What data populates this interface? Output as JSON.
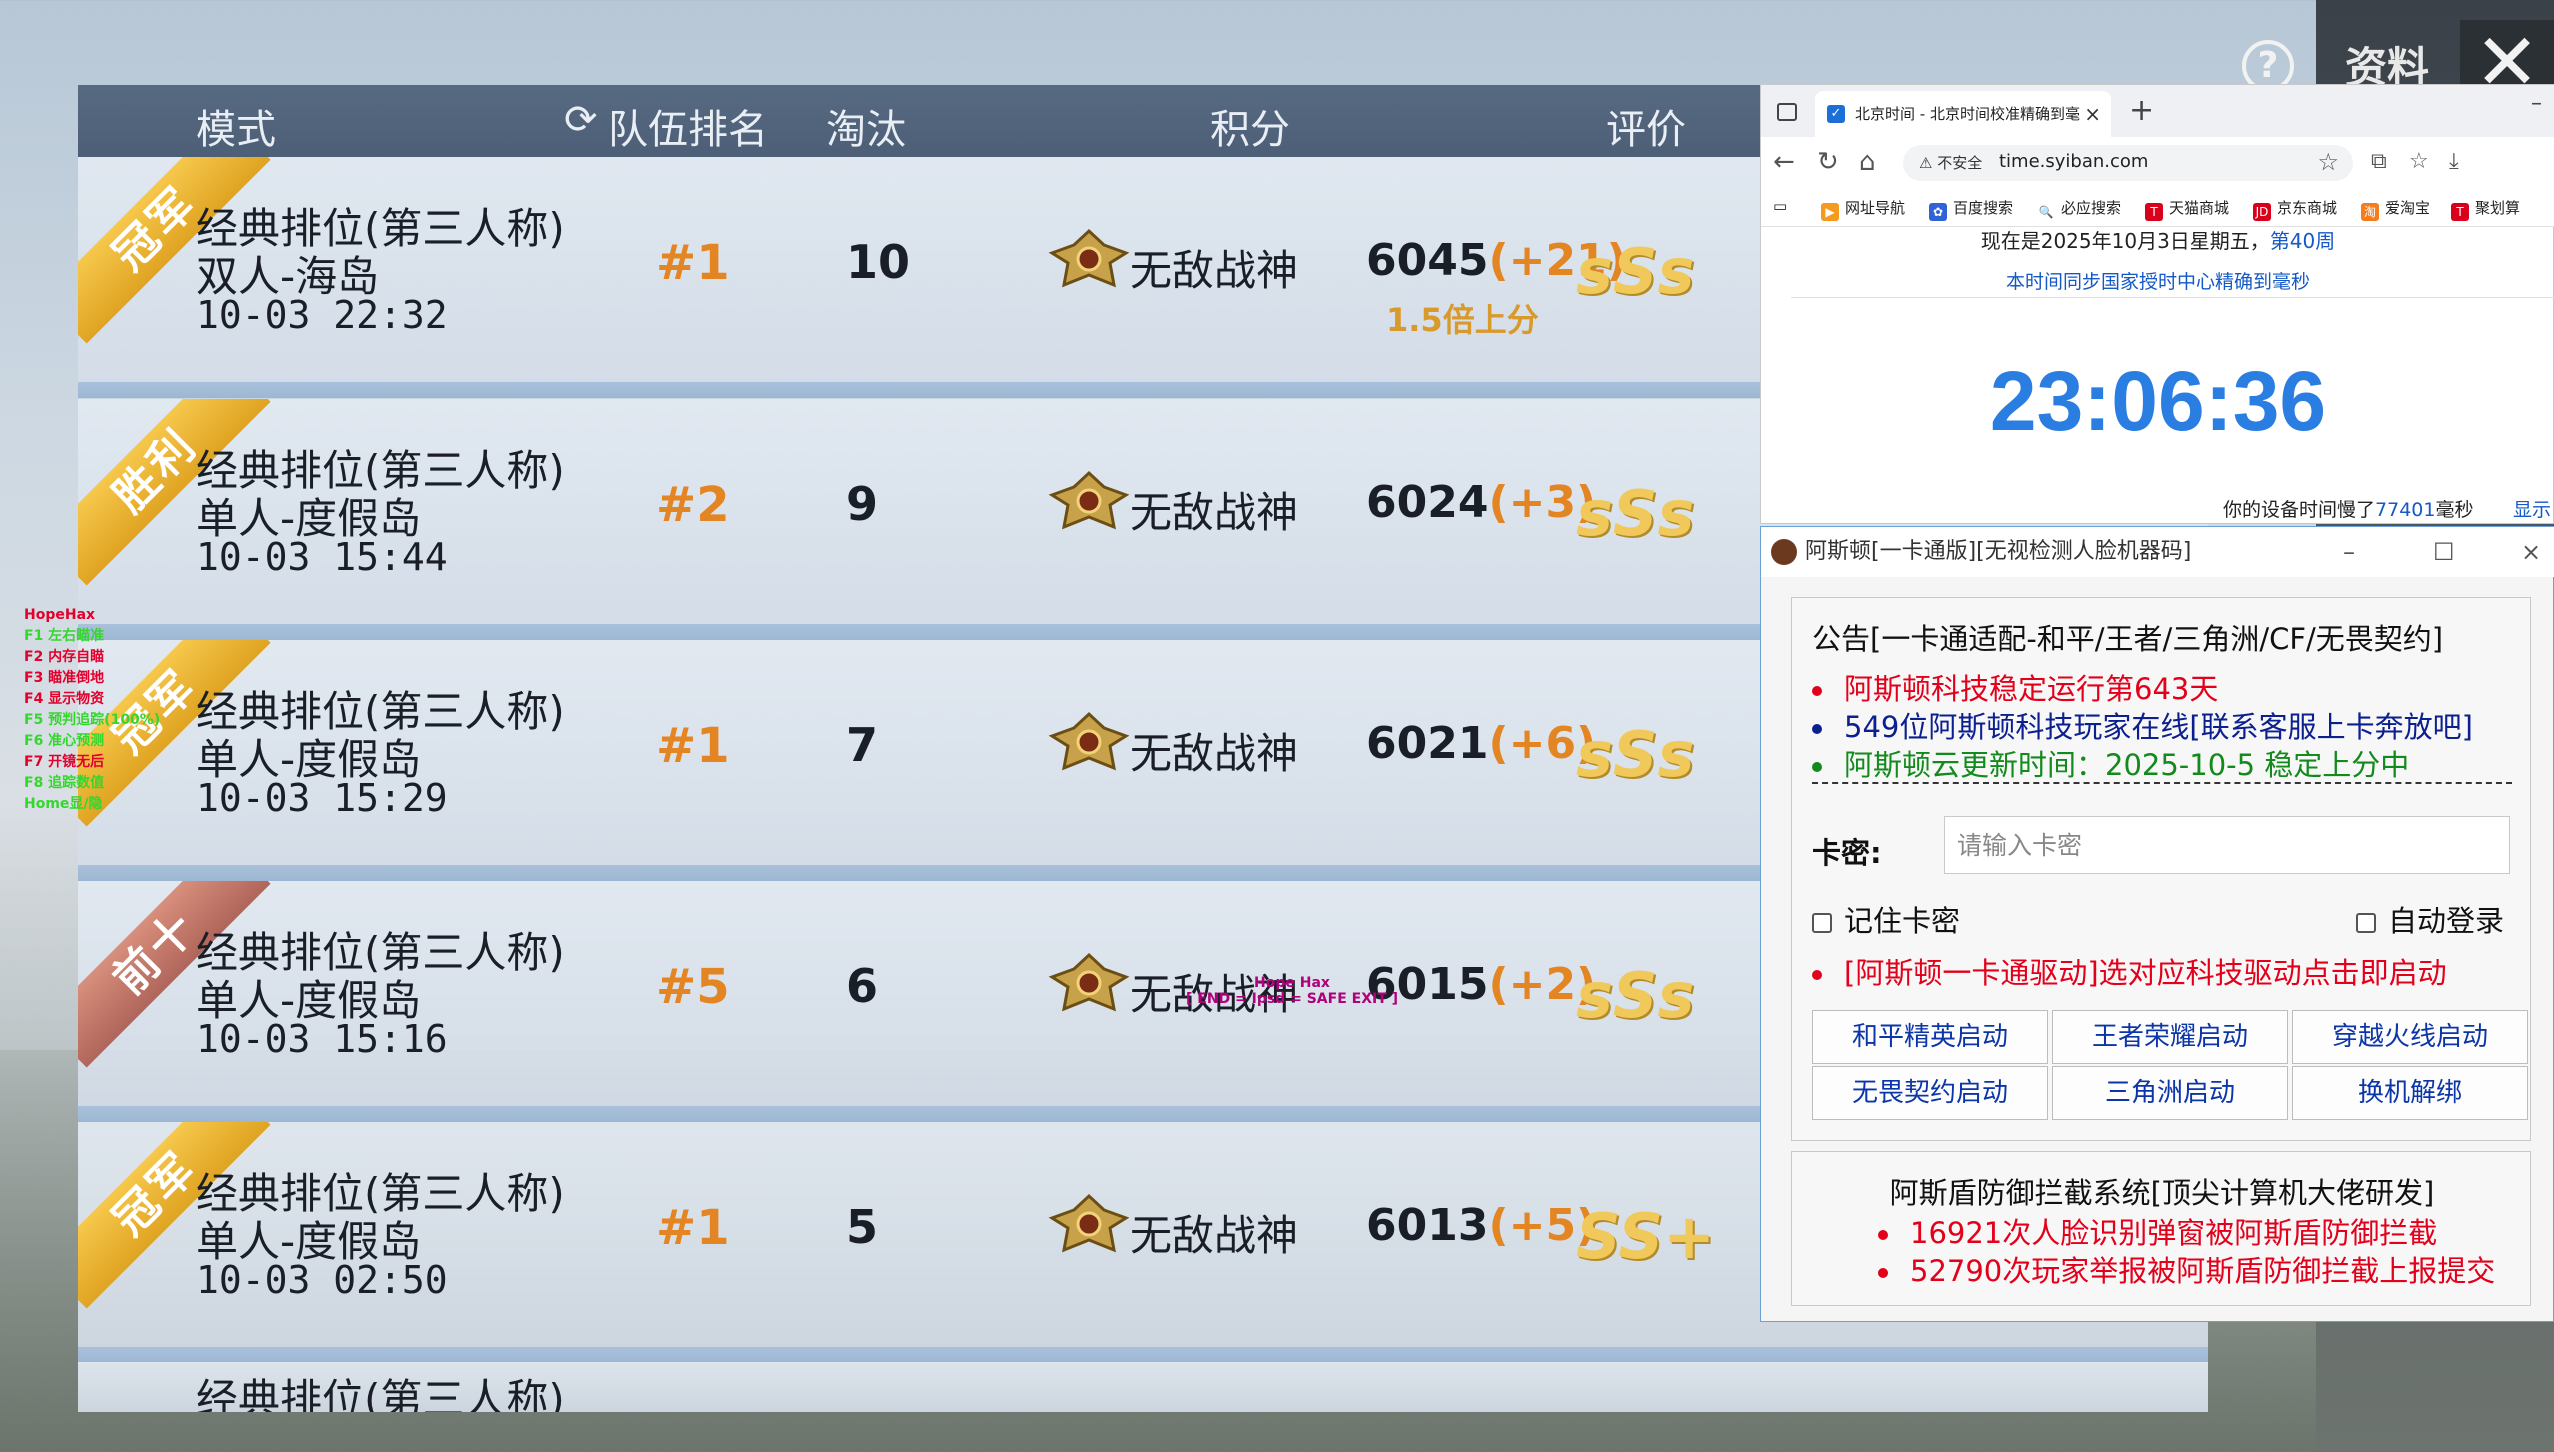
{
  "game": {
    "columns": [
      "模式",
      "队伍排名",
      "淘汰",
      "积分",
      "评价"
    ],
    "rows": [
      {
        "ribbon": "冠军",
        "ribbon_style": "gold",
        "mode": "经典排位(第三人称)",
        "map": "双人-海岛",
        "time": "10-03 22:32",
        "rank": "#1",
        "elims": "10",
        "title": "无敌战神",
        "score": "6045",
        "delta": "(+21)",
        "note": "1.5倍上分",
        "grade": "sSs"
      },
      {
        "ribbon": "胜利",
        "ribbon_style": "gold",
        "mode": "经典排位(第三人称)",
        "map": "单人-度假岛",
        "time": "10-03 15:44",
        "rank": "#2",
        "elims": "9",
        "title": "无敌战神",
        "score": "6024",
        "delta": "(+3)",
        "note": "",
        "grade": "sSs"
      },
      {
        "ribbon": "冠军",
        "ribbon_style": "gold",
        "mode": "经典排位(第三人称)",
        "map": "单人-度假岛",
        "time": "10-03 15:29",
        "rank": "#1",
        "elims": "7",
        "title": "无敌战神",
        "score": "6021",
        "delta": "(+6)",
        "note": "",
        "grade": "sSs"
      },
      {
        "ribbon": "前十",
        "ribbon_style": "silver",
        "mode": "经典排位(第三人称)",
        "map": "单人-度假岛",
        "time": "10-03 15:16",
        "rank": "#5",
        "elims": "6",
        "title": "无敌战神",
        "score": "6015",
        "delta": "(+2)",
        "note": "",
        "grade": "sSs"
      },
      {
        "ribbon": "冠军",
        "ribbon_style": "gold",
        "mode": "经典排位(第三人称)",
        "map": "单人-度假岛",
        "time": "10-03 02:50",
        "rank": "#1",
        "elims": "5",
        "title": "无敌战神",
        "score": "6013",
        "delta": "(+5)",
        "note": "",
        "grade": "SS+"
      }
    ],
    "partial_row": {
      "mode": "经典排位(第三人称)"
    },
    "ziliao": "资料",
    "help": "?",
    "close": "✕"
  },
  "hack_overlay": {
    "title": "HopeHax",
    "lines": [
      {
        "text": "F1 左右瞄准",
        "color": "green"
      },
      {
        "text": "F2 内存自瞄",
        "color": "red"
      },
      {
        "text": "F3 瞄准倒地",
        "color": "red"
      },
      {
        "text": "F4 显示物资",
        "color": "red"
      },
      {
        "text": "F5 预判追踪(100%)",
        "color": "green"
      },
      {
        "text": "F6 准心预测",
        "color": "green"
      },
      {
        "text": "F7 开镜无后",
        "color": "red"
      },
      {
        "text": "F8 追踪数值",
        "color": "green"
      },
      {
        "text": "Home显/隐",
        "color": "green"
      }
    ],
    "esp_line1": "Hope Hax",
    "esp_line2": "[ END = Ipsd = SAFE EXIT ]"
  },
  "browser": {
    "tab_title": "北京时间 - 北京时间校准精确到毫",
    "insecure": "不安全",
    "url": "time.syiban.com",
    "bookmarks": [
      "网址导航",
      "百度搜索",
      "必应搜索",
      "天猫商城",
      "京东商城",
      "爱淘宝",
      "聚划算"
    ],
    "date_text": "现在是2025年10月3日星期五，",
    "week_text": "第40周",
    "sync_text": "本时间同步国家授时中心精确到毫秒",
    "clock": "23:06:36",
    "lag_prefix": "你的设备时间慢了",
    "lag_ms": "77401",
    "lag_suffix": "毫秒",
    "show_more": "显示"
  },
  "dialog": {
    "title": "阿斯顿[一卡通版][无视检测人脸机器码]",
    "notice_title": "公告[一卡通适配-和平/王者/三角洲/CF/无畏契约]",
    "bullets": [
      {
        "text": "阿斯顿科技稳定运行第643天",
        "color": "red"
      },
      {
        "text": "549位阿斯顿科技玩家在线[联系客服上卡奔放吧]",
        "color": "blue"
      },
      {
        "text": "阿斯顿云更新时间：2025-10-5 稳定上分中",
        "color": "green"
      }
    ],
    "kami_label": "卡密:",
    "kami_placeholder": "请输入卡密",
    "remember": "记住卡密",
    "autologin": "自动登录",
    "driver_notice": "[阿斯顿一卡通驱动]选对应科技驱动点击即启动",
    "buttons": [
      "和平精英启动",
      "王者荣耀启动",
      "穿越火线启动",
      "无畏契约启动",
      "三角洲启动",
      "换机解绑"
    ],
    "shield_title": "阿斯盾防御拦截系统[顶尖计算机大佬研发]",
    "shield_bullets": [
      "16921次人脸识别弹窗被阿斯盾防御拦截",
      "52790次玩家举报被阿斯盾防御拦截上报提交"
    ]
  }
}
